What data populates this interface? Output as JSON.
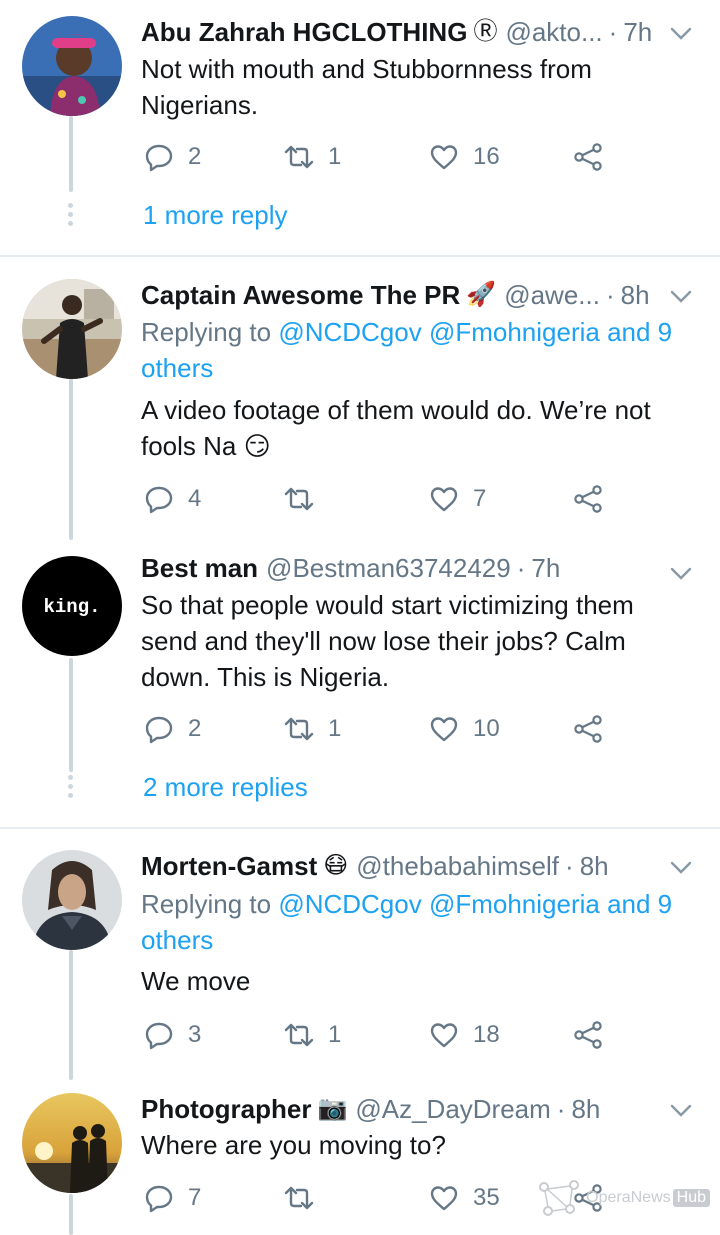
{
  "tweets": [
    {
      "name": "Abu Zahrah HGCLOTHING",
      "badge": "Ⓡ",
      "handle": "@akto...",
      "time": "7h",
      "dot": "·",
      "reply_to_prefix": "",
      "reply_to_link": "",
      "reply_to_link2": "",
      "text": "Not with mouth and Stubbornness from Nigerians.",
      "replies": "2",
      "retweets": "1",
      "likes": "16",
      "more": "1 more reply"
    },
    {
      "name": "Captain Awesome The PR",
      "badge": "🚀",
      "handle": "@awe...",
      "time": "8h",
      "dot": "·",
      "reply_to_prefix": "Replying to ",
      "reply_to_link": "@NCDCgov @Fmohnigeria and 9",
      "reply_to_link2": "others",
      "text": "A video footage of them would do. We’re not fools Na 😏",
      "replies": "4",
      "retweets": "",
      "likes": "7",
      "more": ""
    },
    {
      "name": "Best man",
      "badge": "",
      "handle": "@Bestman63742429",
      "time": "7h",
      "dot": "·",
      "avatar_text": "king.",
      "reply_to_prefix": "",
      "reply_to_link": "",
      "reply_to_link2": "",
      "text": "So that people would start victimizing them send and they'll now lose their jobs? Calm down. This is Nigeria.",
      "replies": "2",
      "retweets": "1",
      "likes": "10",
      "more": "2 more replies"
    },
    {
      "name": "Morten-Gamst",
      "badge": "😷",
      "handle": "@thebabahimself",
      "time": "8h",
      "dot": "·",
      "reply_to_prefix": "Replying to ",
      "reply_to_link": "@NCDCgov @Fmohnigeria and 9",
      "reply_to_link2": "others",
      "text": "We move",
      "replies": "3",
      "retweets": "1",
      "likes": "18",
      "more": ""
    },
    {
      "name": "Photographer",
      "badge": "📷",
      "handle": "@Az_DayDream",
      "time": "8h",
      "dot": "·",
      "reply_to_prefix": "",
      "reply_to_link": "",
      "reply_to_link2": "",
      "text": "Where are you moving to?",
      "replies": "7",
      "retweets": "",
      "likes": "35",
      "more": ""
    }
  ],
  "watermark": {
    "text": "OperaNews",
    "hub": "Hub"
  },
  "icons": {
    "reply": "reply-icon",
    "retweet": "retweet-icon",
    "like": "heart-icon",
    "share": "share-icon",
    "more": "chevron-down-icon"
  },
  "colors": {
    "link": "#1da1f2",
    "muted": "#657786",
    "divider": "#e6ecf0",
    "thread": "#ccd6dd"
  }
}
